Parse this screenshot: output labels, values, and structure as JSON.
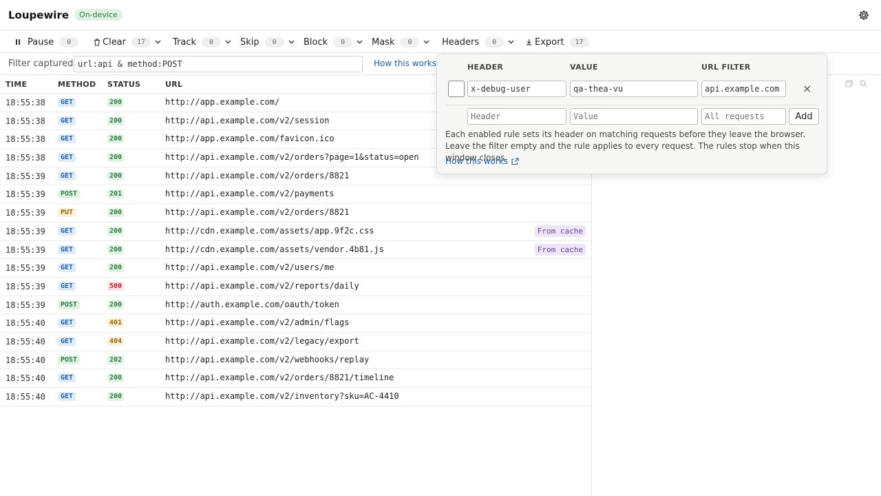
{
  "app": {
    "title": "Loupewire",
    "badge": "On-device"
  },
  "toolbar": {
    "pause": {
      "label": "Pause",
      "count": "0"
    },
    "clear": {
      "label": "Clear",
      "count": "17"
    },
    "track": {
      "label": "Track",
      "count": "0"
    },
    "skip": {
      "label": "Skip",
      "count": "0"
    },
    "block": {
      "label": "Block",
      "count": "0"
    },
    "mask": {
      "label": "Mask",
      "count": "0"
    },
    "headers": {
      "label": "Headers",
      "count": "0"
    },
    "export": {
      "label": "Export",
      "count": "17"
    }
  },
  "filter": {
    "label": "Filter captured",
    "value": "url:api & method:POST",
    "help": "How this works"
  },
  "columns": {
    "time": "TIME",
    "method": "METHOD",
    "status": "STATUS",
    "url": "URL"
  },
  "requests": [
    {
      "time": "18:55:38",
      "method": "GET",
      "status": "200",
      "url": "http://app.example.com/",
      "cache": ""
    },
    {
      "time": "18:55:38",
      "method": "GET",
      "status": "200",
      "url": "http://api.example.com/v2/session",
      "cache": ""
    },
    {
      "time": "18:55:38",
      "method": "GET",
      "status": "200",
      "url": "http://app.example.com/favicon.ico",
      "cache": ""
    },
    {
      "time": "18:55:38",
      "method": "GET",
      "status": "200",
      "url": "http://api.example.com/v2/orders?page=1&status=open",
      "cache": ""
    },
    {
      "time": "18:55:39",
      "method": "GET",
      "status": "200",
      "url": "http://api.example.com/v2/orders/8821",
      "cache": ""
    },
    {
      "time": "18:55:39",
      "method": "POST",
      "status": "201",
      "url": "http://api.example.com/v2/payments",
      "cache": ""
    },
    {
      "time": "18:55:39",
      "method": "PUT",
      "status": "200",
      "url": "http://api.example.com/v2/orders/8821",
      "cache": ""
    },
    {
      "time": "18:55:39",
      "method": "GET",
      "status": "200",
      "url": "http://cdn.example.com/assets/app.9f2c.css",
      "cache": "From cache"
    },
    {
      "time": "18:55:39",
      "method": "GET",
      "status": "200",
      "url": "http://cdn.example.com/assets/vendor.4b81.js",
      "cache": "From cache"
    },
    {
      "time": "18:55:39",
      "method": "GET",
      "status": "200",
      "url": "http://api.example.com/v2/users/me",
      "cache": ""
    },
    {
      "time": "18:55:39",
      "method": "GET",
      "status": "500",
      "url": "http://api.example.com/v2/reports/daily",
      "cache": ""
    },
    {
      "time": "18:55:39",
      "method": "POST",
      "status": "200",
      "url": "http://auth.example.com/oauth/token",
      "cache": ""
    },
    {
      "time": "18:55:40",
      "method": "GET",
      "status": "401",
      "url": "http://api.example.com/v2/admin/flags",
      "cache": ""
    },
    {
      "time": "18:55:40",
      "method": "GET",
      "status": "404",
      "url": "http://api.example.com/v2/legacy/export",
      "cache": ""
    },
    {
      "time": "18:55:40",
      "method": "POST",
      "status": "202",
      "url": "http://api.example.com/v2/webhooks/replay",
      "cache": ""
    },
    {
      "time": "18:55:40",
      "method": "GET",
      "status": "200",
      "url": "http://api.example.com/v2/orders/8821/timeline",
      "cache": ""
    },
    {
      "time": "18:55:40",
      "method": "GET",
      "status": "200",
      "url": "http://api.example.com/v2/inventory?sku=AC-4410",
      "cache": ""
    }
  ],
  "headers_popover": {
    "col_header": "HEADER",
    "col_value": "VALUE",
    "col_filter": "URL FILTER",
    "rule": {
      "header": "x-debug-user",
      "value": "qa-thea-vu",
      "filter": "api.example.com"
    },
    "new_rule": {
      "header_placeholder": "Header",
      "value_placeholder": "Value",
      "filter_placeholder": "All requests"
    },
    "add_label": "Add",
    "description": "Each enabled rule sets its header on matching requests before they leave the browser. Leave the filter empty and the rule applies to every request. The rules stop when this window closes.",
    "help": "How this works"
  }
}
